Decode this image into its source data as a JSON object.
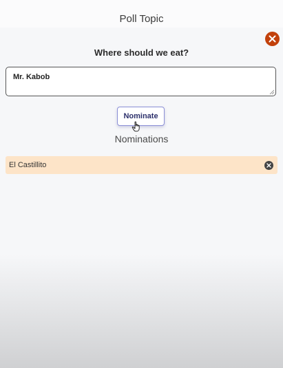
{
  "header": {
    "title": "Poll Topic"
  },
  "form": {
    "question": "Where should we eat?",
    "nominee_value": "Mr. Kabob",
    "nominate_label": "Nominate"
  },
  "nominations": {
    "heading": "Nominations",
    "items": [
      {
        "label": "El Castillito",
        "background": "#fde4c8"
      }
    ]
  },
  "colors": {
    "close_button": "#c2410c",
    "nominate_border": "#8b8fd6",
    "nomination_bg": "#fde4c8"
  },
  "icons": {
    "close": "close-circle-icon",
    "remove": "remove-circle-icon",
    "cursor": "hand-pointer-icon"
  }
}
